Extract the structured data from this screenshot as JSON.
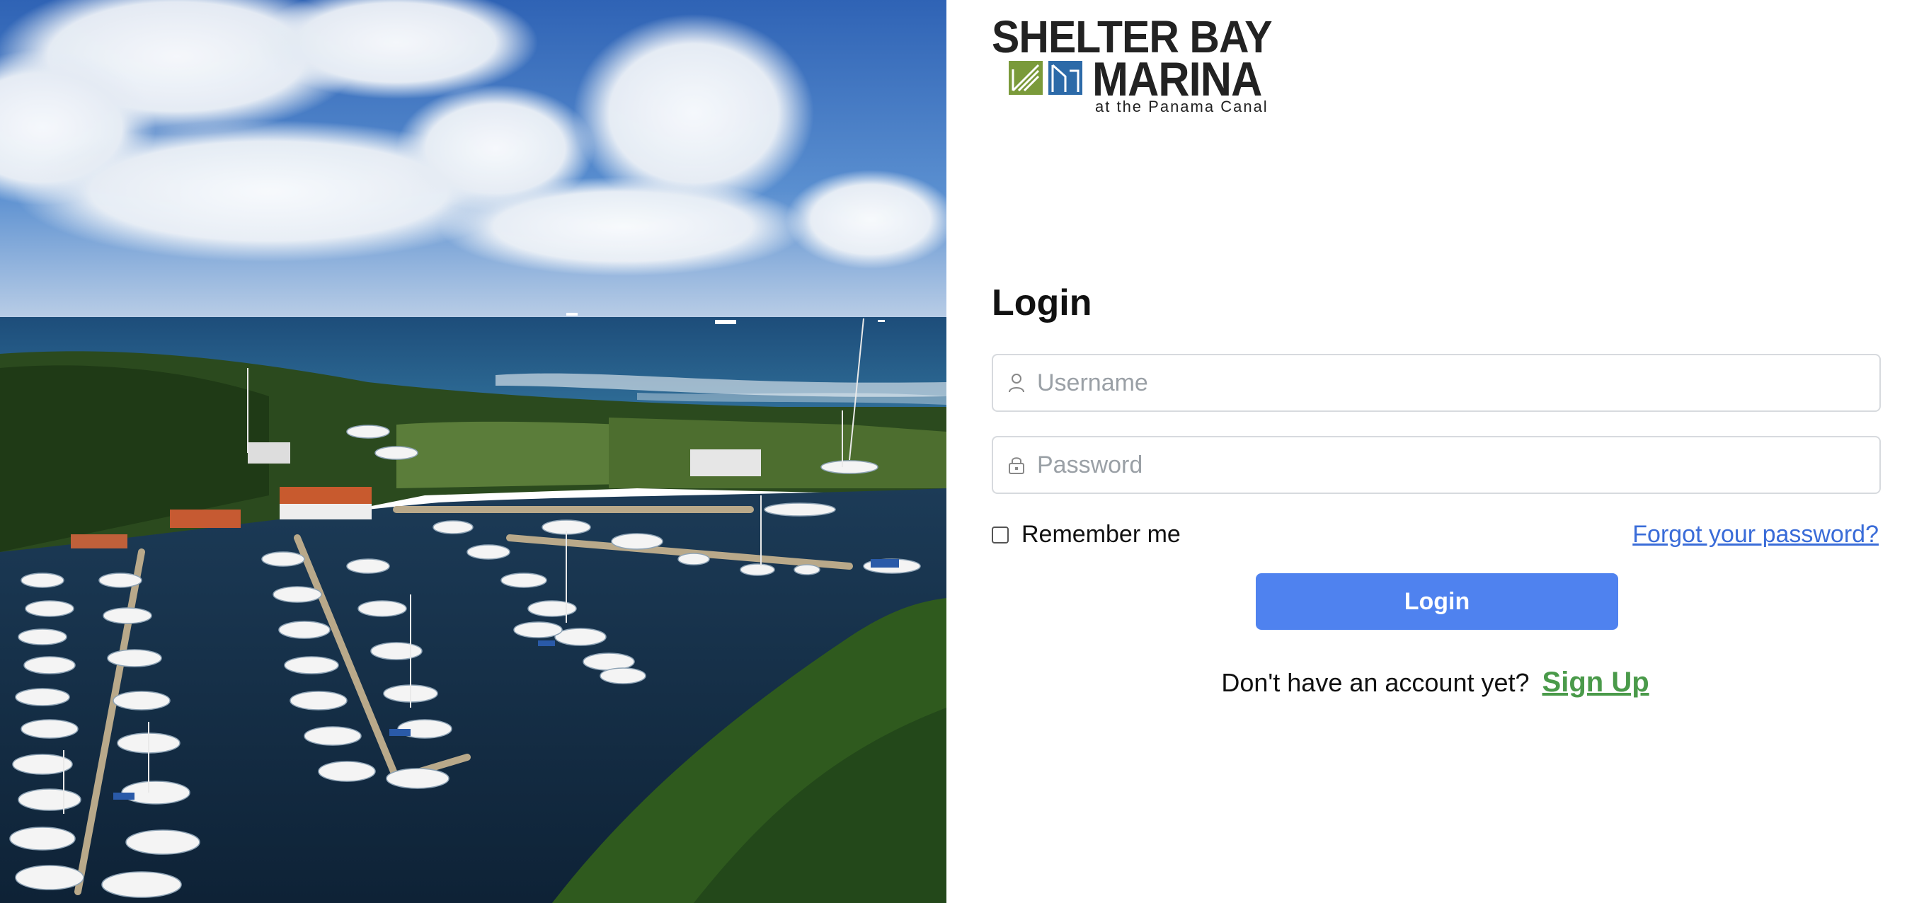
{
  "logo": {
    "line1": "SHELTER BAY",
    "line2": "MARINA",
    "line3": "at the Panama Canal",
    "colors": {
      "green": "#7a9a3a",
      "blue": "#2c6aa8",
      "text": "#222222"
    }
  },
  "photo": {
    "icon": "marina-aerial-photo"
  },
  "form": {
    "title": "Login",
    "username": {
      "placeholder": "Username",
      "value": "",
      "icon": "user-icon"
    },
    "password": {
      "placeholder": "Password",
      "value": "",
      "icon": "lock-icon"
    },
    "remember_label": "Remember me",
    "remember_checked": false,
    "forgot_label": "Forgot your password?",
    "submit_label": "Login",
    "signup_prompt": "Don't have an account yet?",
    "signup_label": "Sign Up"
  },
  "colors": {
    "button": "#4f82ef",
    "link": "#3a6cd8",
    "signup": "#4a9a4a",
    "input_border": "#d7dade"
  }
}
